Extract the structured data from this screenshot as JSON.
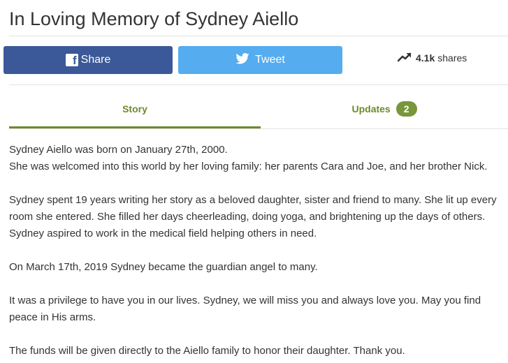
{
  "header": {
    "title": "In Loving Memory of Sydney Aiello"
  },
  "share_bar": {
    "facebook_label": "Share",
    "twitter_label": "Tweet",
    "share_count": "4.1k",
    "share_suffix": "shares",
    "colors": {
      "facebook": "#3b5998",
      "twitter": "#55acee"
    }
  },
  "tabs": {
    "story_label": "Story",
    "updates_label": "Updates",
    "updates_count": "2",
    "active": "Story",
    "accent_color": "#6e8a2b"
  },
  "story": {
    "paragraphs": [
      "Sydney Aiello was born on January 27th, 2000.\nShe was welcomed into this world by her loving family: her parents Cara and Joe, and her brother Nick.",
      "Sydney spent 19 years writing her story as a beloved daughter, sister and friend to many.  She lit up every room she entered.  She filled her days cheerleading, doing yoga, and brightening up the days of others. Sydney aspired to work in the medical field helping others in need.",
      "On March 17th, 2019 Sydney became the guardian angel to many.",
      "It was a privilege to have you in our lives. Sydney, we will miss you and always love you.  May you find peace in His arms.",
      "The funds will be given directly to the Aiello family to honor their daughter. Thank you."
    ]
  }
}
